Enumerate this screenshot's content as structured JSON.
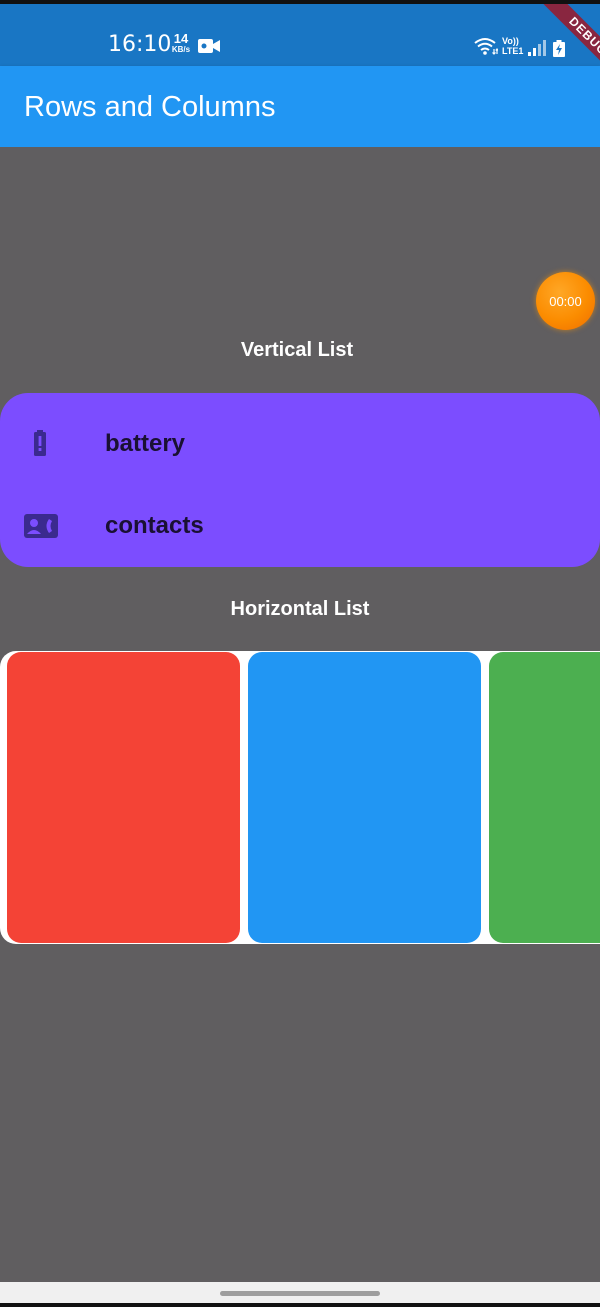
{
  "status_bar": {
    "time": "16:10",
    "net_speed_value": "14",
    "net_speed_unit": "KB/s",
    "volte_line1": "Vo))",
    "volte_line2": "LTE1",
    "icons": [
      "video-camera-icon",
      "wifi-icon",
      "signal-icon",
      "battery-charging-icon"
    ],
    "background": "#1976c4"
  },
  "debug_banner": {
    "label": "DEBUG"
  },
  "app_bar": {
    "title": "Rows and Columns",
    "background": "#2196f3"
  },
  "timer_bubble": {
    "label": "00:00"
  },
  "body": {
    "background": "#605e60"
  },
  "vertical_list": {
    "heading": "Vertical List",
    "background": "#7c4dff",
    "items": [
      {
        "icon": "battery-alert-icon",
        "label": "battery"
      },
      {
        "icon": "contact-phone-icon",
        "label": "contacts"
      }
    ]
  },
  "horizontal_list": {
    "heading": "Horizontal List",
    "background": "#ffffff",
    "cards": [
      {
        "color": "#f44336"
      },
      {
        "color": "#2196f3"
      },
      {
        "color": "#4caf50"
      }
    ]
  }
}
